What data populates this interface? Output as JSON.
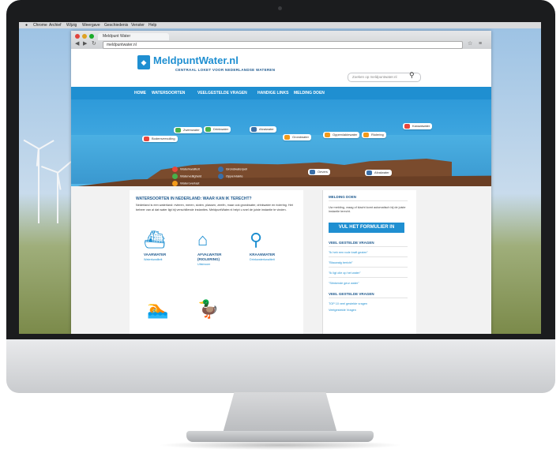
{
  "desktop": {
    "menu": [
      "Chrome",
      "Archief",
      "Wijzig",
      "Weergave",
      "Geschiedenis",
      "Venster",
      "Help"
    ]
  },
  "browser": {
    "tab_title": "Meldpunt Water",
    "url": "meldpuntwater.nl"
  },
  "site": {
    "logo": "MeldpuntWater.nl",
    "tagline": "CENTRAAL LOKET VOOR NEDERLANDSE WATEREN",
    "search_placeholder": "Zoeken op meldpuntwater.nl",
    "nav": [
      "HOME",
      "WATERSOORTEN",
      "VEELGESTELDE VRAGEN",
      "HANDIGE LINKS",
      "MELDING DOEN"
    ]
  },
  "hero": {
    "bubbles": [
      "Zwemwater",
      "Drinkwater",
      "Afvalwater",
      "Grondwater",
      "Bodemvervuiling",
      "Oppervlaktewater",
      "Riolering",
      "Kanaalwater",
      "Oevers",
      "Afvalwater"
    ],
    "legend": [
      "Waterkwaliteit",
      "Waterveiligheid",
      "Wateroverlast",
      "Grondwaterpeil",
      "Oppervlakte"
    ]
  },
  "main": {
    "title": "WATERSOORTEN IN NEDERLAND: WAAR KAN IK TERECHT?",
    "intro": "Nederland is een waterland: rivieren, meren, sloten, plassen, zeeën, maar ook grondwater, drinkwater en riolering. Het beheer van al dat water ligt bij verschillende instanties. MeldpuntWater.nl helpt u snel de juiste instantie te vinden.",
    "categories": [
      {
        "label": "VAARWATER",
        "sub": "Waterkwaliteit",
        "icon": "boat-icon"
      },
      {
        "label": "AFVALWATER",
        "label2": "(RIOLERING)",
        "sub": "Uitstroom",
        "icon": "house-icon"
      },
      {
        "label": "KRAANWATER",
        "sub": "Drinkwaterkwaliteit",
        "icon": "tap-icon"
      },
      {
        "label": "",
        "sub": "",
        "icon": "swimmer-icon"
      },
      {
        "label": "",
        "sub": "",
        "icon": "duck-icon"
      }
    ]
  },
  "sidebar": {
    "melding_title": "MELDING DOEN",
    "melding_text": "Uw melding, vraag of klacht komt automatisch bij de juiste instantie terecht.",
    "button": "VUL HET FORMULIER IN",
    "faq1_title": "VEEL GESTELDE VRAGEN",
    "faq1": [
      "\"Ik heb een rode kraft gezien\"",
      "\"Blauwalg bericht\"",
      "\"Ik ligt olie op het water\"",
      "\"Stinkende geur water\""
    ],
    "faq2_title": "VEEL GESTELDE VRAGEN",
    "faq2": [
      "TOP 10 veel gestelde vragen",
      "Veelgestelde Vragen"
    ]
  },
  "colors": {
    "brand": "#1f8fd1",
    "dark_blue": "#1f5a8f"
  }
}
